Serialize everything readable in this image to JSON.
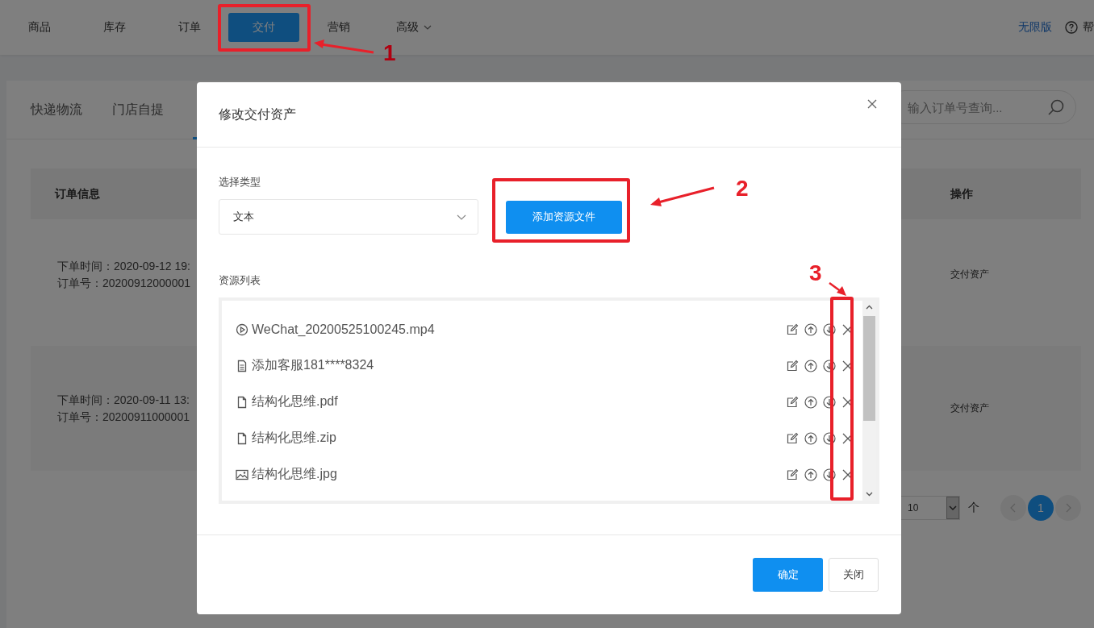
{
  "nav": {
    "items": [
      {
        "label": "商品",
        "selected": false,
        "dropdown": false
      },
      {
        "label": "库存",
        "selected": false,
        "dropdown": false
      },
      {
        "label": "订单",
        "selected": false,
        "dropdown": false
      },
      {
        "label": "交付",
        "selected": true,
        "dropdown": false
      },
      {
        "label": "营销",
        "selected": false,
        "dropdown": false
      },
      {
        "label": "高级",
        "selected": false,
        "dropdown": true
      }
    ],
    "edition": "无限版",
    "help": "帮"
  },
  "delivery_tabs": [
    {
      "label": "快递物流"
    },
    {
      "label": "门店自提"
    }
  ],
  "search": {
    "placeholder": "输入订单号查询..."
  },
  "orders_table": {
    "columns": [
      "订单信息",
      "操作"
    ],
    "rows": [
      {
        "order_time": "下单时间：2020-09-12 19:",
        "order_no": "订单号：20200912000001",
        "action": "交付资产"
      },
      {
        "order_time": "下单时间：2020-09-11 13:",
        "order_no": "订单号：20200911000001",
        "action": "交付资产"
      }
    ]
  },
  "pagination": {
    "page_size": "10",
    "unit": "个",
    "pages": [
      {
        "label": "1",
        "selected": true
      }
    ]
  },
  "dialog": {
    "title": "修改交付资产",
    "type_label": "选择类型",
    "type_value": "文本",
    "add_button": "添加资源文件",
    "list_label": "资源列表",
    "resources": [
      {
        "kind": "video",
        "name": "WeChat_20200525100245.mp4"
      },
      {
        "kind": "text",
        "name": "添加客服181****8324"
      },
      {
        "kind": "file",
        "name": "结构化思维.pdf"
      },
      {
        "kind": "file",
        "name": "结构化思维.zip"
      },
      {
        "kind": "image",
        "name": "结构化思维.jpg"
      }
    ],
    "buttons": [
      {
        "label": "确定",
        "primary": true
      },
      {
        "label": "关闭",
        "primary": false
      }
    ]
  },
  "annotations": [
    {
      "number": "1"
    },
    {
      "number": "2"
    },
    {
      "number": "3"
    }
  ]
}
